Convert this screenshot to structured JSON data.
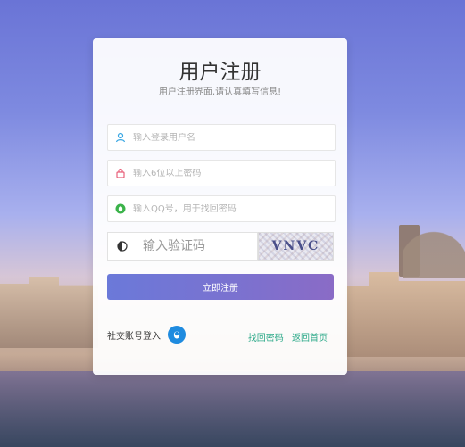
{
  "title": "用户注册",
  "subtitle": "用户注册界面,请认真填写信息!",
  "fields": {
    "username": {
      "placeholder": "输入登录用户名"
    },
    "password": {
      "placeholder": "输入6位以上密码"
    },
    "qq": {
      "placeholder": "输入QQ号，用于找回密码"
    },
    "captcha": {
      "placeholder": "输入验证码",
      "image_text": "VNVC"
    }
  },
  "submit_label": "立即注册",
  "social": {
    "label": "社交账号登入"
  },
  "links": {
    "forgot": "找回密码",
    "home": "返回首页"
  },
  "colors": {
    "accent_gradient_start": "#6b79d9",
    "accent_gradient_end": "#8a6bc6",
    "link": "#2eaa8a",
    "qq_blue": "#1f8bdf"
  }
}
